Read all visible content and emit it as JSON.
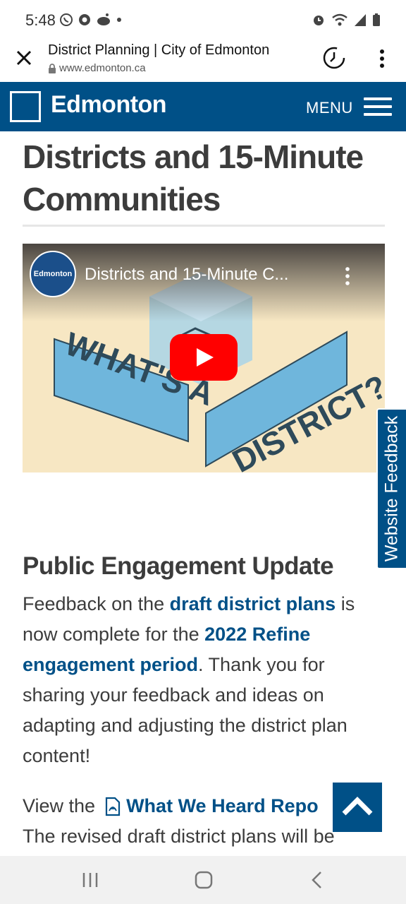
{
  "status": {
    "time": "5:48",
    "left_icons": [
      "whatsapp-icon",
      "chrome-icon",
      "reddit-icon",
      "dot-icon"
    ],
    "right_icons": [
      "alarm-icon",
      "wifi-icon",
      "signal-icon",
      "battery-icon"
    ]
  },
  "browser": {
    "page_title": "District Planning | City of Edmonton",
    "url": "www.edmonton.ca"
  },
  "header": {
    "logo_text": "Edmonton",
    "menu_label": "MENU",
    "brand_color": "#005087"
  },
  "main": {
    "heading": "Districts and 15-Minute Communities",
    "video": {
      "channel": "Edmonton",
      "title": "Districts and 15-Minute C..."
    },
    "engagement": {
      "heading": "Public Engagement Update",
      "text1": "Feedback on the ",
      "link1": "draft district plans",
      "text2": " is now complete for the ",
      "link2": "2022 Refine engagement period",
      "text3": ". Thank you for sharing your feedback and ideas on adapting and adjusting the district plan content!"
    },
    "report": {
      "prefix": "View the",
      "link": "What We Heard Repo",
      "line2": "The revised draft district plans will be"
    }
  },
  "feedback_tab": {
    "label": "Website Feedback"
  }
}
